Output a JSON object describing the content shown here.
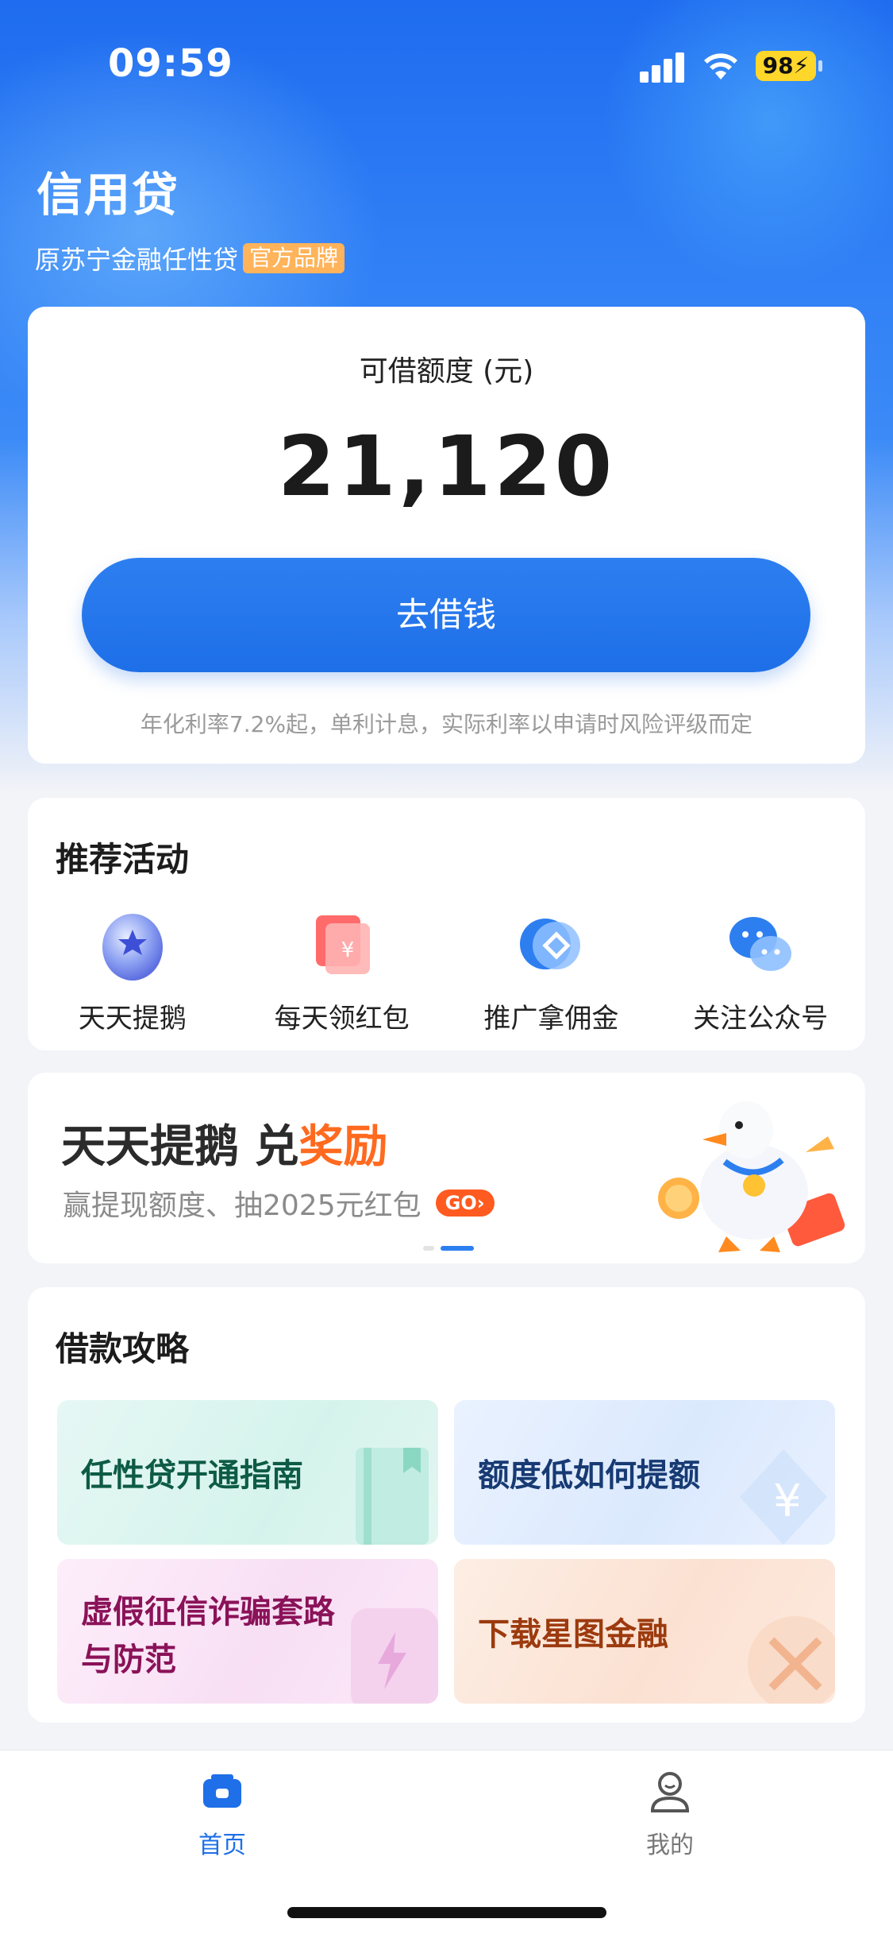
{
  "status_bar": {
    "time": "09:59",
    "battery": "98"
  },
  "brand": {
    "title": "信用贷",
    "subtitle": "原苏宁金融任性贷",
    "badge": "官方品牌"
  },
  "loan": {
    "label": "可借额度 (元)",
    "amount": "21,120",
    "button": "去借钱",
    "note": "年化利率7.2%起，单利计息，实际利率以申请时风险评级而定"
  },
  "activities": {
    "title": "推荐活动",
    "items": [
      {
        "label": "天天提鹅",
        "icon": "egg-icon"
      },
      {
        "label": "每天领红包",
        "icon": "red-envelope-icon"
      },
      {
        "label": "推广拿佣金",
        "icon": "promote-coin-icon"
      },
      {
        "label": "关注公众号",
        "icon": "wechat-icon"
      }
    ]
  },
  "banner": {
    "title_main": "天天提鹅 兑",
    "title_accent": "奖励",
    "subtitle": "赢提现额度、抽2025元红包",
    "go_label": "GO›",
    "active_slide": 2,
    "slide_count": 2
  },
  "guides": {
    "title": "借款攻略",
    "items": [
      {
        "label": "任性贷开通指南",
        "color": "#0d5b45"
      },
      {
        "label": "额度低如何提额",
        "color": "#173a73"
      },
      {
        "label": "虚假征信诈骗套路\n与防范",
        "line1": "虚假征信诈骗套路",
        "line2": "与防范",
        "color": "#8a1258"
      },
      {
        "label": "下载星图金融",
        "color": "#9c3a0e"
      }
    ]
  },
  "tabs": [
    {
      "label": "首页",
      "active": true
    },
    {
      "label": "我的",
      "active": false
    }
  ],
  "colors": {
    "primary": "#1e6fe8",
    "accent": "#ff6a1f"
  }
}
